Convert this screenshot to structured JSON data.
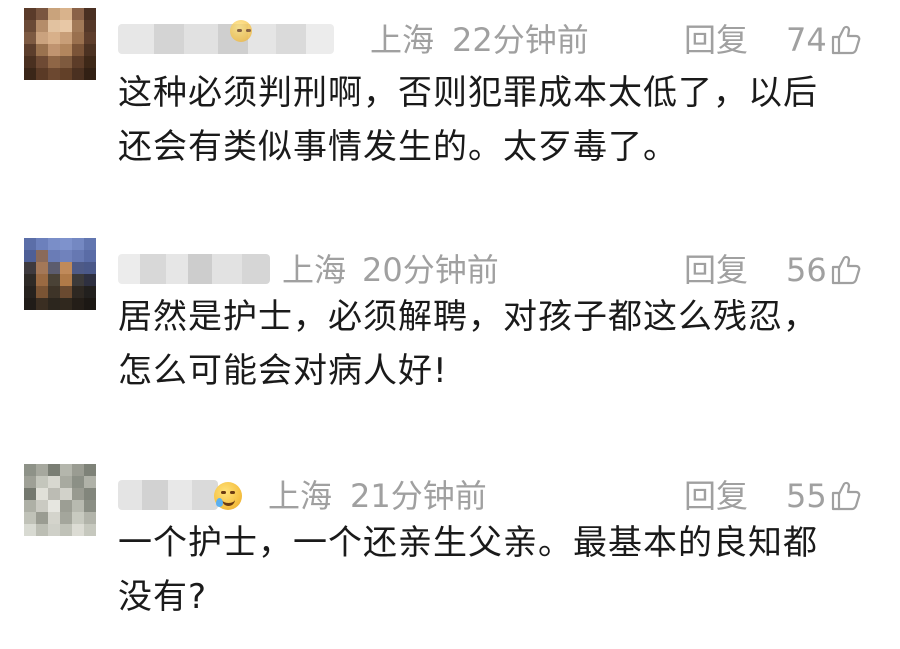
{
  "comments": [
    {
      "location": "上海",
      "time": "22分钟前",
      "reply_label": "回复",
      "likes": "74",
      "content_lines": [
        "这种必须判刑啊，否则犯罪成本太低了，以后",
        "还会有类似事情发生的。太歹毒了。"
      ]
    },
    {
      "location": "上海",
      "time": "20分钟前",
      "reply_label": "回复",
      "likes": "56",
      "content_lines": [
        "居然是护士，必须解聘，对孩子都这么残忍，",
        "怎么可能会对病人好!"
      ]
    },
    {
      "location": "上海",
      "time": "21分钟前",
      "reply_label": "回复",
      "likes": "55",
      "content_lines": [
        "一个护士，一个还亲生父亲。最基本的良知都",
        "没有?"
      ]
    }
  ],
  "icons": {
    "like": "thumbs-up-outline-icon",
    "emoji": "laughing-tears-emoji-icon",
    "avatar": "pixelated-avatar"
  },
  "colors": {
    "meta_text": "#a0a0a0",
    "content_text": "#1a1a1a",
    "background": "#ffffff"
  }
}
